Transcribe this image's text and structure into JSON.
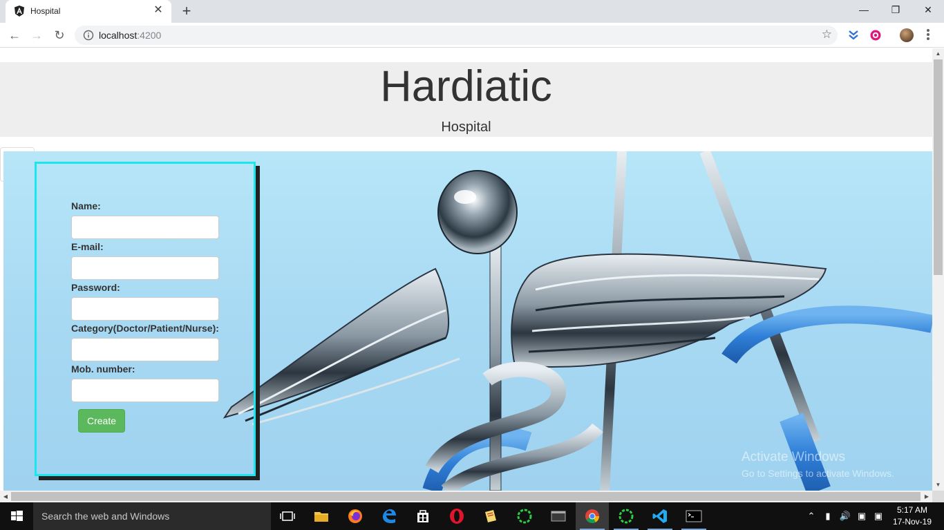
{
  "browser": {
    "tab_title": "Hospital",
    "url_host": "localhost",
    "url_port": ":4200",
    "new_tab_symbol": "+",
    "close_tab_symbol": "✕"
  },
  "page": {
    "title": "Hardiatic",
    "subtitle": "Hospital",
    "form": {
      "name_label": "Name:",
      "email_label": "E-mail:",
      "password_label": "Password:",
      "category_label": "Category(Doctor/Patient/Nurse):",
      "mobile_label": "Mob. number:",
      "create_label": "Create"
    },
    "watermark": {
      "line1": "Activate Windows",
      "line2": "Go to Settings to activate Windows."
    }
  },
  "taskbar": {
    "search_placeholder": "Search the web and Windows",
    "time": "5:17 AM",
    "date": "17-Nov-19"
  },
  "colors": {
    "card_border": "#19e6ef",
    "create_button": "#5cb85c",
    "jumbotron_bg": "#eeeeee"
  }
}
